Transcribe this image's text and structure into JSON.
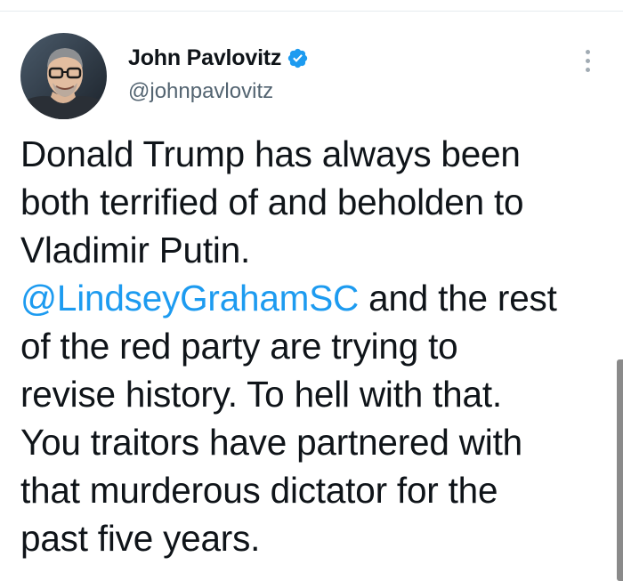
{
  "tweet": {
    "author": {
      "display_name": "John Pavlovitz",
      "handle": "@johnpavlovitz",
      "verified": true
    },
    "text_lines": [
      {
        "text": "Donald Trump has always been"
      },
      {
        "text": "both terrified of and beholden to"
      },
      {
        "text": "Vladimir Putin."
      },
      {
        "mention": "@LindseyGrahamSC",
        "text": " and the rest"
      },
      {
        "text": "of the red party are trying to"
      },
      {
        "text": "revise history. To hell with that."
      },
      {
        "text": "You traitors have partnered with"
      },
      {
        "text": "that murderous dictator for the"
      },
      {
        "text": "past five years."
      }
    ]
  },
  "icons": {
    "verified": "verified-badge-icon",
    "more": "more-options-icon"
  },
  "colors": {
    "text": "#0f1419",
    "secondary_text": "#536471",
    "link": "#1d9bf0",
    "verified_badge": "#1d9bf0",
    "more_dots": "#a1abb3",
    "scrollbar": "#8a8a8a",
    "background": "#ffffff"
  }
}
